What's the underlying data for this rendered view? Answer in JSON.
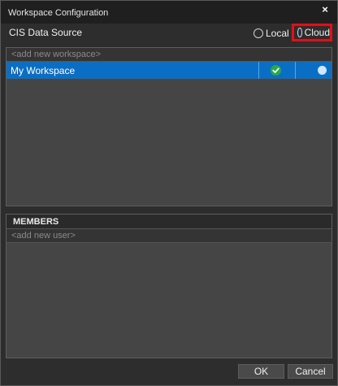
{
  "window": {
    "title": "Workspace Configuration",
    "close_glyph": "×"
  },
  "source": {
    "label": "CIS Data Source",
    "options": [
      {
        "label": "Local",
        "selected": false
      },
      {
        "label": "Cloud",
        "selected": true
      }
    ],
    "highlight_color": "#e0101a"
  },
  "workspaces": {
    "add_placeholder": "<add new workspace>",
    "rows": [
      {
        "name": "My Workspace",
        "status_icon": "green-check-icon",
        "selected": true
      }
    ],
    "selection_color": "#0a6fc4"
  },
  "members": {
    "header": "MEMBERS",
    "add_placeholder": "<add new user>"
  },
  "buttons": {
    "ok": "OK",
    "cancel": "Cancel"
  }
}
